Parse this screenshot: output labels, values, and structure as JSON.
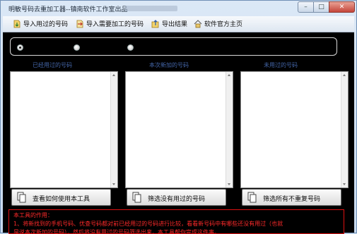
{
  "window": {
    "title": "明敏号码去重加工器--镇南软件工作室出品",
    "controls": {
      "minimize": "–",
      "maximize": "□",
      "close": "✕"
    }
  },
  "toolbar": {
    "items": [
      {
        "label": "导入用过的号码",
        "icon": "import-icon"
      },
      {
        "label": "导入需要加工的号码",
        "icon": "import-process-icon"
      },
      {
        "label": "导出结果",
        "icon": "export-icon"
      },
      {
        "label": "软件官方主页",
        "icon": "home-icon"
      }
    ]
  },
  "mode_selector": {
    "selected_index": 0,
    "option_count": 3
  },
  "columns": [
    {
      "label": "已经用过的号码",
      "content": ""
    },
    {
      "label": "本次新加的号码",
      "content": ""
    },
    {
      "label": "未用过的号码",
      "content": ""
    }
  ],
  "buttons": {
    "help": "查看如何使用本工具",
    "filter_unused": "筛选没有用过的号码",
    "filter_unique": "筛选所有不重复号码"
  },
  "info": {
    "title": "本工具的作用：",
    "line1": "1、将新找到的手机号码、优查号码都对前已经用过的号码进行比较，看看新号码中有哪些还没有用过（也就",
    "line2": "是说本次新加的号码），然后将没有用过的号码筛选出来，本工具帮你完成这件事。"
  },
  "colors": {
    "client_bg": "#000000",
    "label_blue": "#4466a9",
    "info_red": "#ff2a2a"
  }
}
